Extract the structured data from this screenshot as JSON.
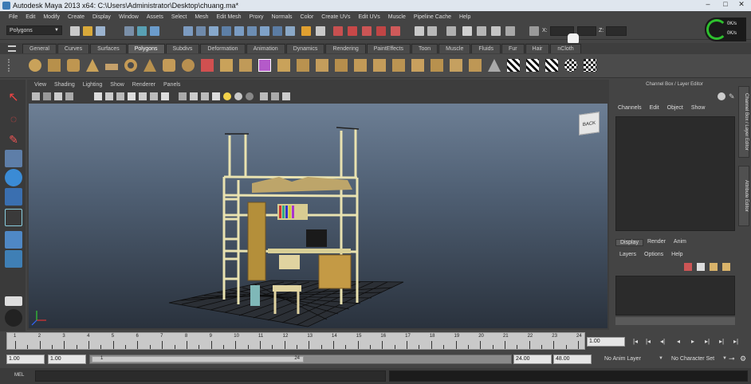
{
  "window": {
    "title": "Autodesk Maya 2013 x64: C:\\Users\\Administrator\\Desktop\\chuang.ma*"
  },
  "menu": [
    "File",
    "Edit",
    "Modify",
    "Create",
    "Display",
    "Window",
    "Assets",
    "Select",
    "Mesh",
    "Edit Mesh",
    "Proxy",
    "Normals",
    "Color",
    "Create UVs",
    "Edit UVs",
    "Muscle",
    "Pipeline Cache",
    "Help"
  ],
  "status": {
    "mode": "Polygons",
    "x_label": "X:",
    "z_label": "Z:",
    "perf_top": "0K/s",
    "perf_bottom": "0K/s"
  },
  "shelf_tabs": [
    "General",
    "Curves",
    "Surfaces",
    "Polygons",
    "Subdivs",
    "Deformation",
    "Animation",
    "Dynamics",
    "Rendering",
    "PaintEffects",
    "Toon",
    "Muscle",
    "Fluids",
    "Fur",
    "Hair",
    "nCloth"
  ],
  "active_shelf_tab": "Polygons",
  "viewport": {
    "menu": [
      "View",
      "Shading",
      "Lighting",
      "Show",
      "Renderer",
      "Panels"
    ],
    "cube_label": "BACK"
  },
  "channel_box": {
    "title": "Channel Box / Layer Editor",
    "menu": [
      "Channels",
      "Edit",
      "Object",
      "Show"
    ],
    "side_tab_1": "Channel Box / Layer Editor",
    "side_tab_2": "Attribute Editor",
    "layer_tabs": [
      "Display",
      "Render",
      "Anim"
    ],
    "active_layer_tab": "Display",
    "layer_menu": [
      "Layers",
      "Options",
      "Help"
    ]
  },
  "timeline": {
    "ticks": [
      "1",
      "2",
      "3",
      "4",
      "5",
      "6",
      "7",
      "8",
      "9",
      "10",
      "11",
      "12",
      "13",
      "14",
      "15",
      "16",
      "17",
      "18",
      "19",
      "20",
      "21",
      "22",
      "23",
      "24"
    ],
    "current_frame": "1.00"
  },
  "range": {
    "start": "1.00",
    "playback_start": "1.00",
    "slider_start": "1",
    "slider_end": "24",
    "playback_end": "24.00",
    "end": "48.00",
    "anim_layer": "No Anim Layer",
    "char_set": "No Character Set"
  },
  "cmdline": {
    "label": "MEL"
  },
  "colors": {
    "accent": "#5a7fb0",
    "viewport_top": "#6d7f95",
    "viewport_bottom": "#2a323d"
  }
}
